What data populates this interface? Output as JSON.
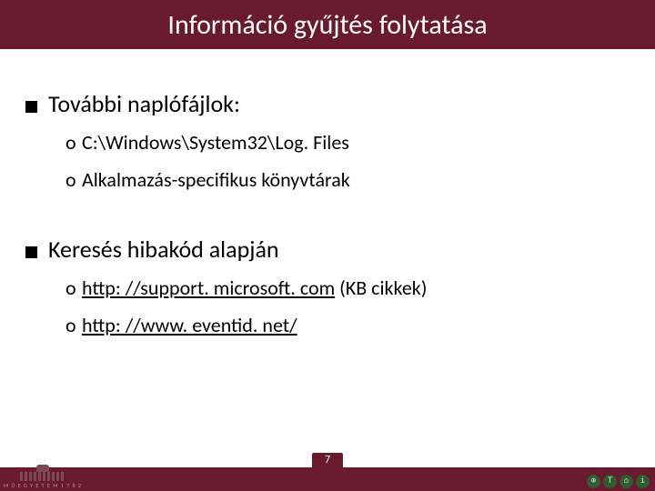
{
  "title": "Információ gyűjtés folytatása",
  "sections": [
    {
      "heading": "További naplófájlok:",
      "items": [
        {
          "text": "C:\\Windows\\System32\\Log. Files",
          "link": false,
          "suffix": ""
        },
        {
          "text": "Alkalmazás-specifikus könyvtárak",
          "link": false,
          "suffix": ""
        }
      ]
    },
    {
      "heading": "Keresés hibakód alapján",
      "items": [
        {
          "text": "http: //support. microsoft. com",
          "link": true,
          "suffix": " (KB cikkek)"
        },
        {
          "text": "http: //www. eventid. net/",
          "link": true,
          "suffix": ""
        }
      ]
    }
  ],
  "footer": {
    "slide_number": "7",
    "org_text": "M Ű E G Y E T E M   1 7 8 2",
    "badges": [
      "⊕",
      "T",
      "⌂",
      "i"
    ]
  }
}
